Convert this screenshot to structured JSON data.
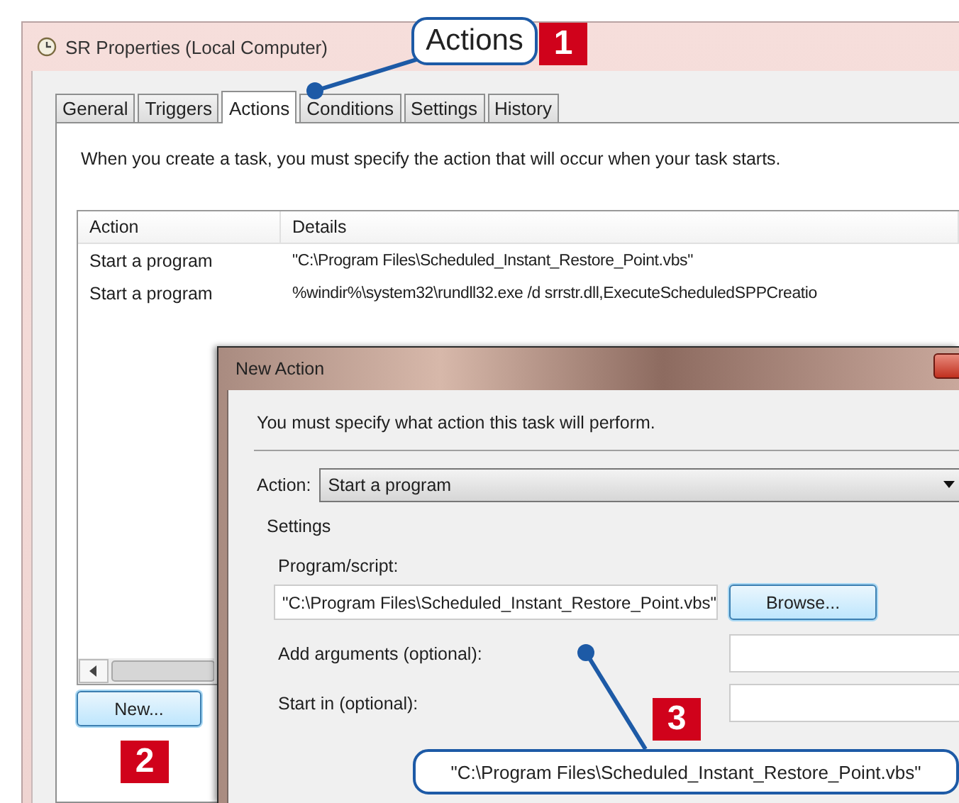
{
  "properties_window": {
    "title": "SR Properties (Local Computer)",
    "tabs": [
      {
        "label": "General",
        "selected": false
      },
      {
        "label": "Triggers",
        "selected": false
      },
      {
        "label": "Actions",
        "selected": true
      },
      {
        "label": "Conditions",
        "selected": false
      },
      {
        "label": "Settings",
        "selected": false
      },
      {
        "label": "History",
        "selected": false
      }
    ],
    "description": "When you create a task, you must specify the action that will occur when your task starts.",
    "table": {
      "columns": [
        "Action",
        "Details"
      ],
      "rows": [
        [
          "Start a program",
          "\"C:\\Program Files\\Scheduled_Instant_Restore_Point.vbs\""
        ],
        [
          "Start a program",
          "%windir%\\system32\\rundll32.exe /d srrstr.dll,ExecuteScheduledSPPCreatio"
        ]
      ]
    },
    "new_button": "New..."
  },
  "new_action_dialog": {
    "title": "New Action",
    "instruction": "You must specify what action this task will perform.",
    "action_label": "Action:",
    "action_value": "Start a program",
    "settings_label": "Settings",
    "program_label": "Program/script:",
    "program_value": "\"C:\\Program Files\\Scheduled_Instant_Restore_Point.vbs\"",
    "browse_button": "Browse...",
    "arguments_label": "Add arguments (optional):",
    "start_in_label": "Start in (optional):"
  },
  "callouts": [
    {
      "number": "1",
      "text": "Actions"
    },
    {
      "number": "2"
    },
    {
      "number": "3",
      "text": "\"C:\\Program Files\\Scheduled_Instant_Restore_Point.vbs\""
    }
  ]
}
